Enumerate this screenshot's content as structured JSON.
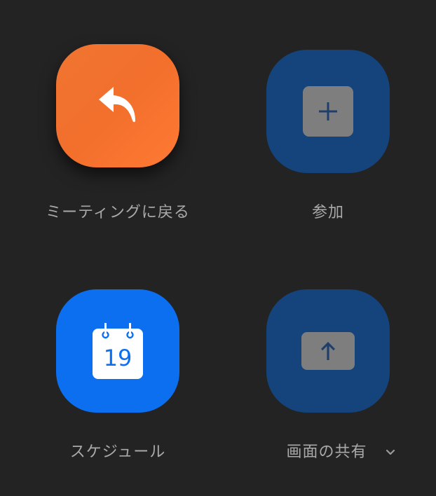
{
  "tiles": [
    {
      "id": "back-to-meeting",
      "label": "ミーティングに戻る",
      "icon": "reply-arrow-icon",
      "color": "#f0722f"
    },
    {
      "id": "join",
      "label": "参加",
      "icon": "plus-icon",
      "color": "#14447b"
    },
    {
      "id": "schedule",
      "label": "スケジュール",
      "icon": "calendar-icon",
      "color": "#0b6ff0",
      "calendar_day": "19"
    },
    {
      "id": "share-screen",
      "label": "画面の共有",
      "icon": "upload-arrow-icon",
      "color": "#14447b",
      "has_dropdown": true
    }
  ],
  "colors": {
    "background": "#232323",
    "label_text": "#a9a9a9",
    "orange": "#f0722f",
    "navy": "#14447b",
    "blue": "#0b6ff0",
    "gray_box": "#7e7e7e"
  }
}
